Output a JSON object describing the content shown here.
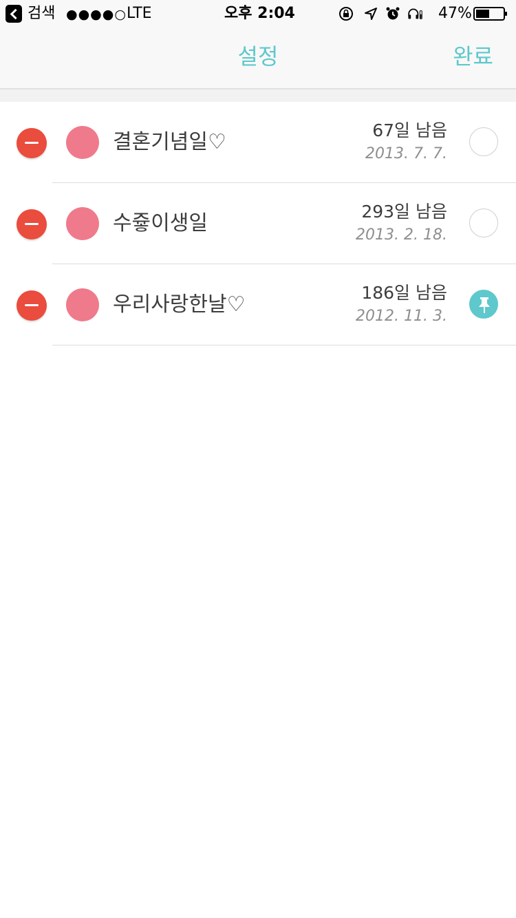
{
  "status_bar": {
    "back_label": "검색",
    "signal": "●●●●○",
    "carrier": "LTE",
    "time": "오후 2:04",
    "battery": "47%"
  },
  "nav": {
    "title": "설정",
    "done": "완료"
  },
  "colors": {
    "accent": "#5ec8cc",
    "delete": "#ea4c3d",
    "dot": "#ef7a8b"
  },
  "items": [
    {
      "title": "결혼기념일♡",
      "remaining": "67일 남음",
      "date": "2013. 7. 7.",
      "pinned": false
    },
    {
      "title": "수즇이생일",
      "remaining": "293일 남음",
      "date": "2013. 2. 18.",
      "pinned": false
    },
    {
      "title": "우리사랑한날♡",
      "remaining": "186일 남음",
      "date": "2012. 11. 3.",
      "pinned": true
    }
  ]
}
